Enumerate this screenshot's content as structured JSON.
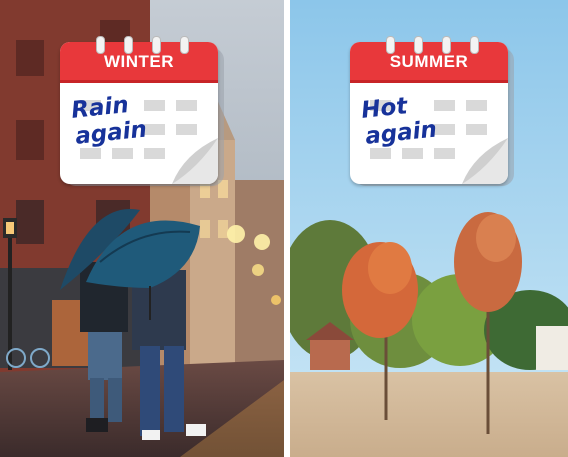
{
  "left_panel": {
    "calendar": {
      "title": "WINTER",
      "note_line1": "Rain",
      "note_line2": "again"
    }
  },
  "right_panel": {
    "calendar": {
      "title": "SUMMER",
      "note_line1": "Hot",
      "note_line2": "again"
    }
  },
  "colors": {
    "calendar_header": "#e8383b",
    "handwriting": "#17329a",
    "umbrella": "#1f5a7a",
    "sky_summer": "#a7d3ee",
    "autumn_foliage": "#d4683a"
  }
}
